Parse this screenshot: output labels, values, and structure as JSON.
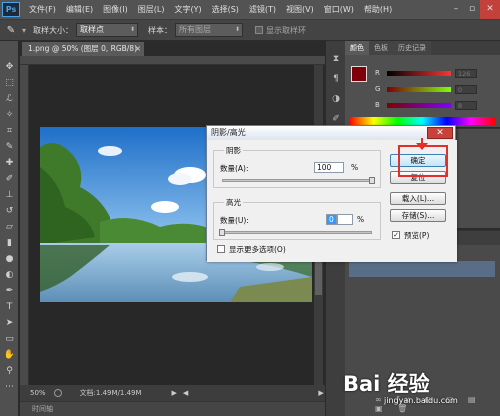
{
  "app": {
    "logo": "Ps"
  },
  "menu": [
    "文件(F)",
    "编辑(E)",
    "图像(I)",
    "图层(L)",
    "文字(Y)",
    "选择(S)",
    "滤镜(T)",
    "视图(V)",
    "窗口(W)",
    "帮助(H)"
  ],
  "window_controls": {
    "minimize": "–",
    "restore": "▫",
    "close": "✕"
  },
  "options_bar": {
    "sample_size_label": "取样大小：",
    "sample_size_value": "取样点",
    "sample_label": "样本：",
    "sample_value": "所有图层",
    "show_ring_label": "显示取样环"
  },
  "document": {
    "tab_title": "1.png @ 50% (图层 0, RGB/8)",
    "tab_close": "×",
    "zoom": "50%",
    "doc_info": "文档:1.49M/1.49M"
  },
  "timeline": {
    "label": "时间轴"
  },
  "color_panel": {
    "tabs": [
      "颜色",
      "色板",
      "历史记录"
    ],
    "channels": [
      {
        "label": "R",
        "value": "126"
      },
      {
        "label": "G",
        "value": "0"
      },
      {
        "label": "B",
        "value": "8"
      }
    ],
    "foreground_color": "#7e0008",
    "background_color": "#ffffff"
  },
  "dialog": {
    "title": "阴影/高光",
    "close": "✕",
    "shadows": {
      "group_title": "阴影",
      "amount_label": "数量(A):",
      "amount_value": "100",
      "unit": "%",
      "amount_fraction": 1.0
    },
    "highlights": {
      "group_title": "高光",
      "amount_label": "数量(U):",
      "amount_value": "0",
      "unit": "%",
      "amount_fraction": 0.0
    },
    "more_options_label": "显示更多选项(O)",
    "buttons": {
      "ok": "确定",
      "reset": "复位",
      "load": "载入(L)...",
      "save": "存储(S)...",
      "preview": "预览(P)"
    },
    "preview_checked": true,
    "more_options_checked": false
  },
  "watermark": {
    "text": "Bai 经验",
    "url": "jingyan.baidu.com"
  },
  "colors": {
    "annotation_red": "#e0302b"
  }
}
